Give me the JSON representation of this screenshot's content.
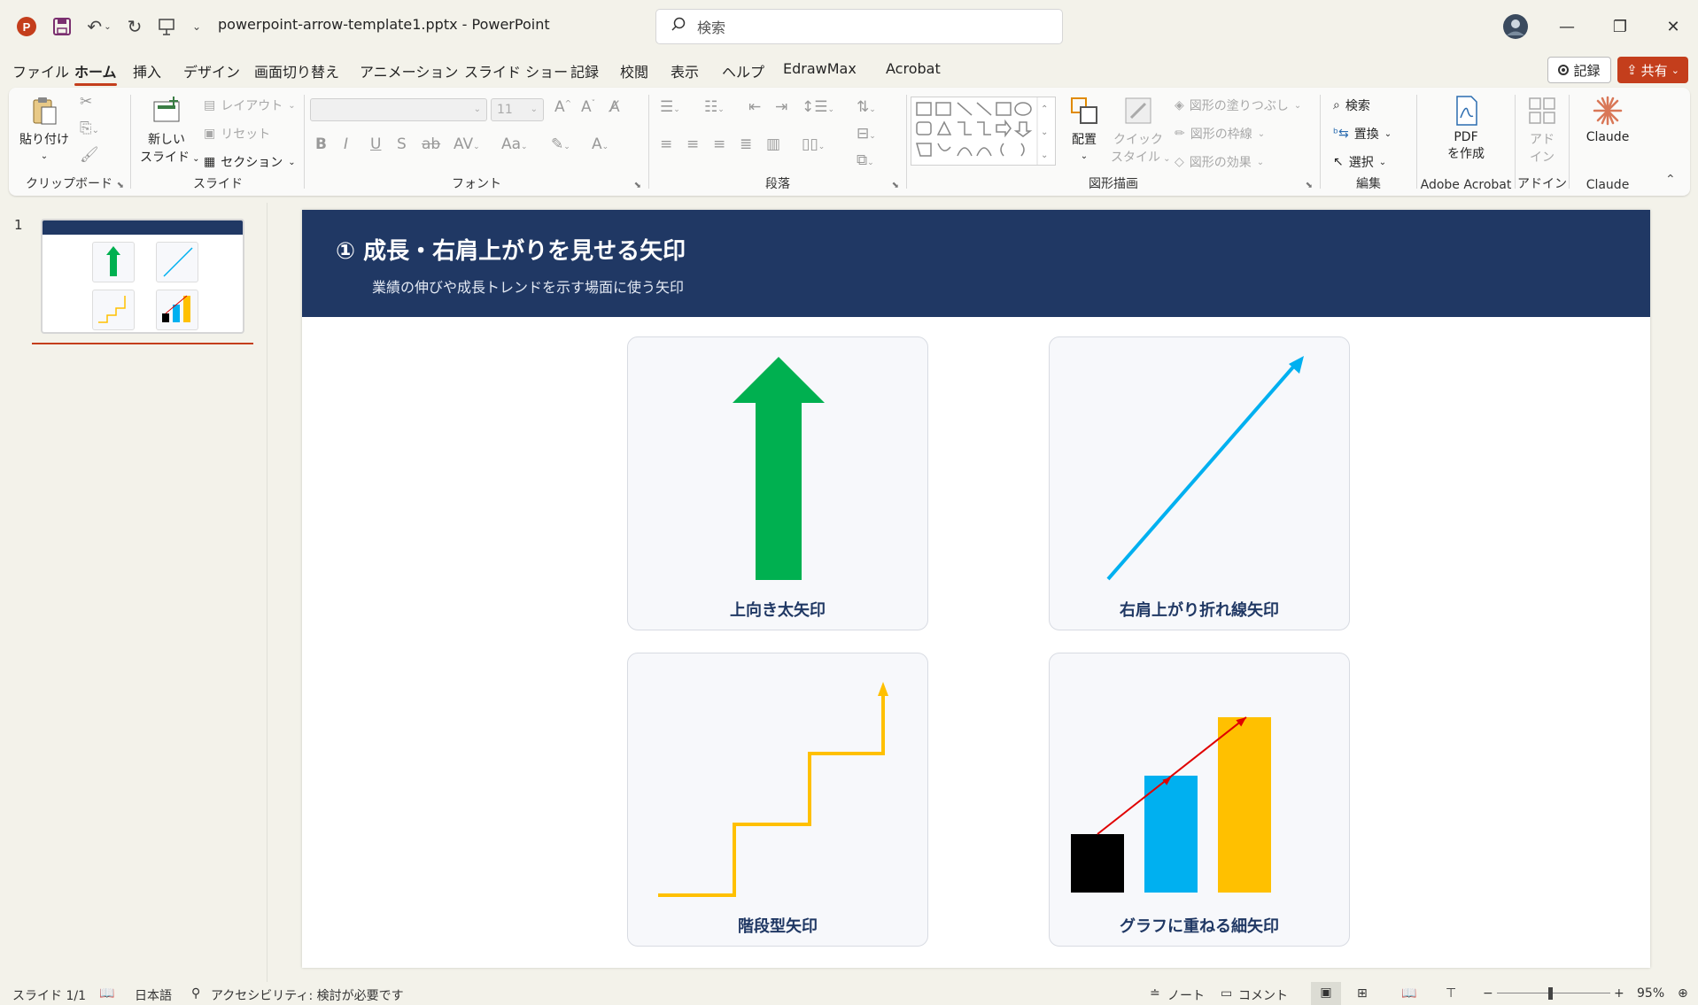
{
  "app": {
    "doc_title": "powerpoint-arrow-template1.pptx  -  PowerPoint",
    "search_placeholder": "検索"
  },
  "menu": {
    "tabs": [
      "ファイル",
      "ホーム",
      "挿入",
      "デザイン",
      "画面切り替え",
      "アニメーション",
      "スライド ショー",
      "記録",
      "校閲",
      "表示",
      "ヘルプ",
      "EdrawMax",
      "Acrobat"
    ],
    "active": "ホーム",
    "record_label": "記録",
    "share_label": "共有"
  },
  "ribbon": {
    "clipboard": {
      "paste": "貼り付け",
      "label": "クリップボード"
    },
    "slides": {
      "new_slide_1": "新しい",
      "new_slide_2": "スライド",
      "layout": "レイアウト",
      "reset": "リセット",
      "section": "セクション",
      "label": "スライド"
    },
    "font": {
      "size": "11",
      "label": "フォント"
    },
    "paragraph": {
      "label": "段落"
    },
    "drawing": {
      "arrange": "配置",
      "quick_style_1": "クイック",
      "quick_style_2": "スタイル",
      "fill": "図形の塗りつぶし",
      "outline": "図形の枠線",
      "effects": "図形の効果",
      "label": "図形描画"
    },
    "editing": {
      "find": "検索",
      "replace": "置換",
      "select": "選択",
      "label": "編集"
    },
    "acrobat": {
      "pdf_1": "PDF",
      "pdf_2": "を作成",
      "label": "Adobe Acrobat"
    },
    "addins": {
      "addin_1": "アド",
      "addin_2": "イン",
      "label": "アドイン"
    },
    "claude": {
      "button": "Claude",
      "label": "Claude"
    }
  },
  "slides_pane": {
    "slide_number": "1"
  },
  "slide": {
    "title": "① 成長・右肩上がりを見せる矢印",
    "subtitle": "業績の伸びや成長トレンドを示す場面に使う矢印",
    "cards": [
      {
        "label": "上向き太矢印"
      },
      {
        "label": "右肩上がり折れ線矢印"
      },
      {
        "label": "階段型矢印"
      },
      {
        "label": "グラフに重ねる細矢印"
      }
    ],
    "bar_values": [
      1,
      2,
      3
    ]
  },
  "status": {
    "slide_count": "スライド 1/1",
    "language": "日本語",
    "accessibility": "アクセシビリティ: 検討が必要です",
    "notes": "ノート",
    "comments": "コメント",
    "zoom": "95%"
  },
  "colors": {
    "accent": "#c43e1c",
    "header": "#203864",
    "green_arrow": "#00b050",
    "blue_line": "#00b0f0",
    "stair": "#ffc000",
    "red_arrow": "#e00000"
  }
}
